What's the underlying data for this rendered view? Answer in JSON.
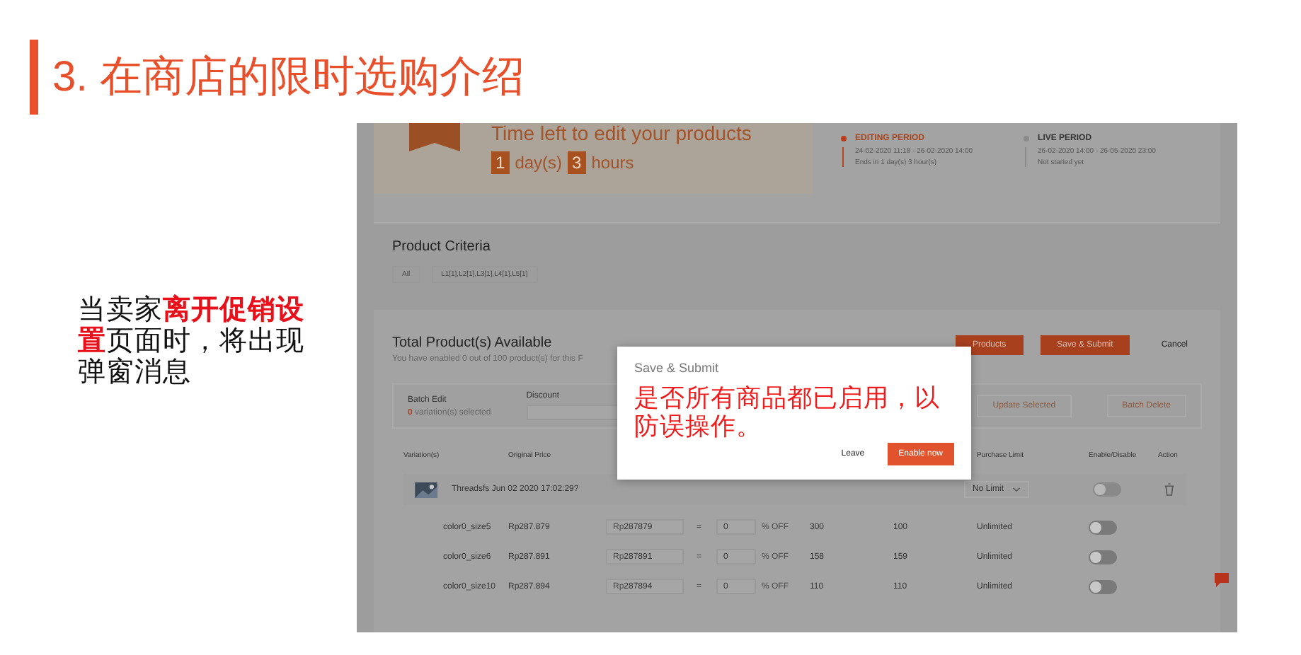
{
  "title": "3. 在商店的限时选购介绍",
  "note": "当卖家**离开促销设置**页面时，将出现弹窗消息",
  "screenshot": {
    "timer": {
      "heading": "Time left to edit your products",
      "days": "1",
      "days_unit": "day(s)",
      "hours": "3",
      "hours_unit": "hours"
    },
    "periods": [
      {
        "label": "EDITING PERIOD",
        "dates": "24-02-2020 11:18 - 26-02-2020 14:00",
        "status": "Ends in 1 day(s) 3 hour(s)",
        "selected": true
      },
      {
        "label": "LIVE PERIOD",
        "dates": "26-02-2020 14:00 - 26-05-2020 23:00",
        "status": "Not started yet",
        "selected": false
      }
    ],
    "criteria": {
      "title": "Product Criteria",
      "items": [
        "All",
        "L1[1],L2[1],L3[1],L4[1],L5[1]"
      ]
    },
    "products": {
      "title": "Total Product(s) Available",
      "subtitle": "You have enabled 0 out of 100 product(s) for this F",
      "buttons": [
        "Products",
        "Save & Submit"
      ],
      "cancel": "Cancel"
    },
    "batch": {
      "label": "Batch Edit",
      "selected_count": "0",
      "selected_text": "variation(s) selected",
      "field_label": "Discount",
      "buttons": [
        "Update Selected",
        "Batch Delete"
      ]
    },
    "columns": [
      "Variation(s)",
      "Original Price",
      "Purchase Limit",
      "Enable/Disable",
      "Action"
    ],
    "group": {
      "name": "Threadsfs Jun 02 2020 17:02:29?",
      "limit": "No Limit",
      "enabled": false
    },
    "rows": [
      {
        "variation": "color0_size5",
        "price": "Rp287.879",
        "currency": "Rp",
        "discount_price": "287879",
        "equals": "=",
        "discount": "0",
        "off": "% OFF",
        "stock": "300",
        "stock_2": "100",
        "limit": "Unlimited",
        "enabled": false
      },
      {
        "variation": "color0_size6",
        "price": "Rp287.891",
        "currency": "Rp",
        "discount_price": "287891",
        "equals": "=",
        "discount": "0",
        "off": "% OFF",
        "stock": "158",
        "stock_2": "159",
        "limit": "Unlimited",
        "enabled": false
      },
      {
        "variation": "color0_size10",
        "price": "Rp287.894",
        "currency": "Rp",
        "discount_price": "287894",
        "equals": "=",
        "discount": "0",
        "off": "% OFF",
        "stock": "110",
        "stock_2": "110",
        "limit": "Unlimited",
        "enabled": false
      }
    ],
    "modal": {
      "title": "Save & Submit",
      "message": "是否所有商品都已启用，以防误操作。",
      "buttons": [
        {
          "label": "Leave",
          "kind": "text"
        },
        {
          "label": "Enable now",
          "kind": "primary"
        }
      ]
    }
  }
}
